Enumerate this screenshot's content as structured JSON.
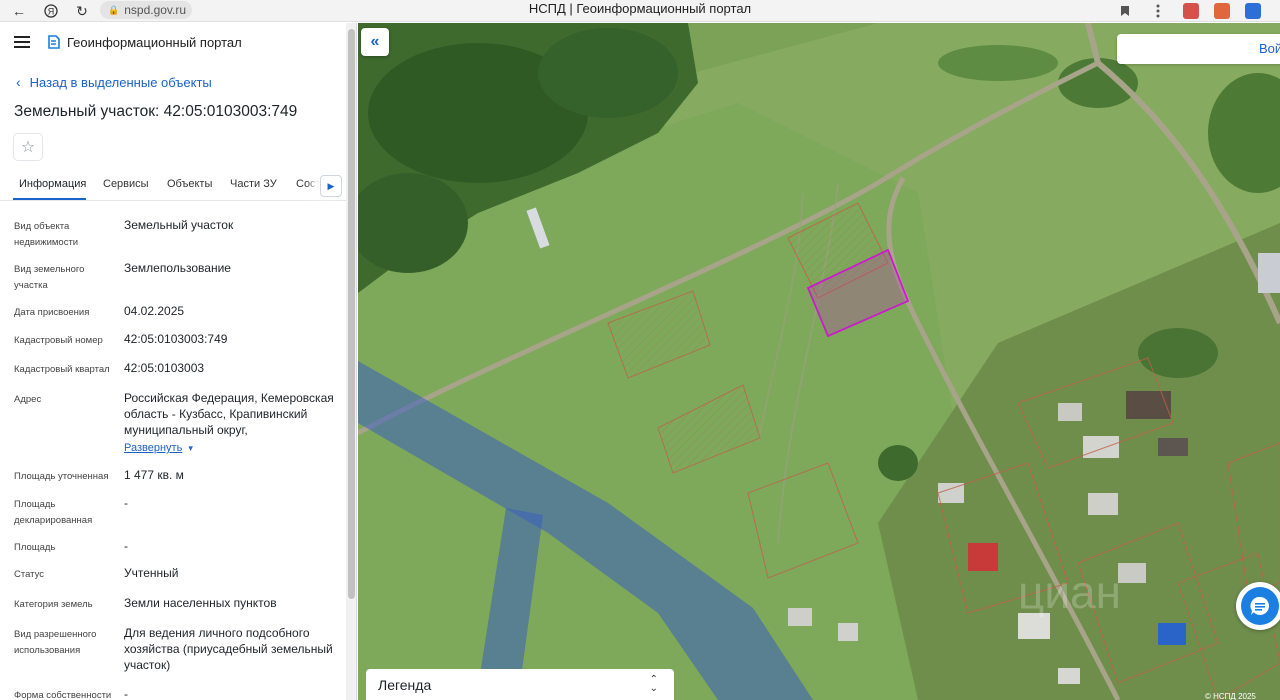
{
  "browser": {
    "url": "nspd.gov.ru",
    "page_title": "НСПД | Геоинформационный портал"
  },
  "panel": {
    "portal_name": "Геоинформационный портал",
    "back_label": "Назад в выделенные объекты",
    "title": "Земельный участок: 42:05:0103003:749",
    "tabs": [
      "Информация",
      "Сервисы",
      "Объекты",
      "Части ЗУ",
      "Соста"
    ],
    "rows": [
      {
        "label": "Вид объекта недвижимости",
        "value": "Земельный участок"
      },
      {
        "label": "Вид земельного участка",
        "value": "Землепользование"
      },
      {
        "label": "Дата присвоения",
        "value": "04.02.2025"
      },
      {
        "label": "Кадастровый номер",
        "value": "42:05:0103003:749"
      },
      {
        "label": "Кадастровый квартал",
        "value": "42:05:0103003"
      },
      {
        "label": "Адрес",
        "value": "Российская Федерация, Кемеровская область - Кузбасс, Крапивинский муниципальный округ,"
      },
      {
        "label": "Площадь уточненная",
        "value": "1 477 кв. м"
      },
      {
        "label": "Площадь декларированная",
        "value": "-"
      },
      {
        "label": "Площадь",
        "value": "-"
      },
      {
        "label": "Статус",
        "value": "Учтенный"
      },
      {
        "label": "Категория земель",
        "value": "Земли населенных пунктов"
      },
      {
        "label": "Вид разрешенного использования",
        "value": "Для ведения личного подсобного хозяйства (приусадебный земельный участок)"
      },
      {
        "label": "Форма собственности",
        "value": "-"
      }
    ],
    "expand_label": "Развернуть"
  },
  "map": {
    "login_label": "Войти",
    "legend_label": "Легенда",
    "copyright": "© НСПД 2025"
  },
  "colors": {
    "accent": "#1a63c8",
    "selected_parcel": "#c81ec8",
    "parcel_outline": "#c0604a"
  }
}
